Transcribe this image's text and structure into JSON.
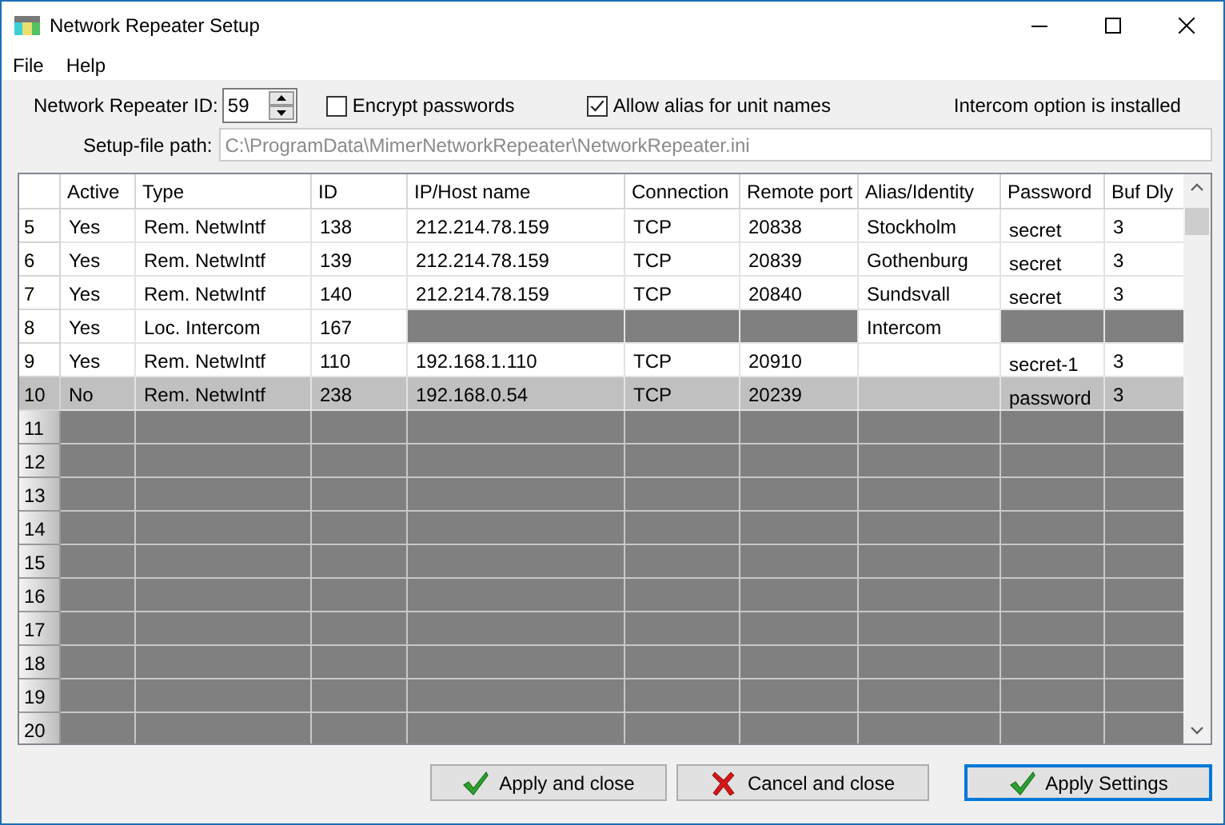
{
  "window": {
    "title": "Network Repeater Setup"
  },
  "menu": [
    "File",
    "Help"
  ],
  "settings": {
    "repeater_id": {
      "label": "Network Repeater ID:",
      "value": "59"
    },
    "options": [
      {
        "label": "Encrypt passwords",
        "checked": false
      },
      {
        "label": "Allow alias for unit names",
        "checked": true
      }
    ],
    "status": "Intercom option is installed",
    "setup_file": {
      "label": "Setup-file path:",
      "value": "C:\\ProgramData\\MimerNetworkRepeater\\NetworkRepeater.ini",
      "disabled": true
    }
  },
  "table": {
    "columns": [
      "Active",
      "Type",
      "ID",
      "IP/Host name",
      "Connection",
      "Remote port",
      "Alias/Identity",
      "Password",
      "Buf Dly"
    ],
    "rows": [
      {
        "number": "5",
        "selected": false,
        "disabled": false,
        "cells": [
          {
            "text": "Yes",
            "disabled": false
          },
          {
            "text": "Rem. NetwIntf",
            "disabled": false
          },
          {
            "text": "138",
            "disabled": false
          },
          {
            "text": "212.214.78.159",
            "disabled": false
          },
          {
            "text": "TCP",
            "disabled": false
          },
          {
            "text": "20838",
            "disabled": false
          },
          {
            "text": "Stockholm",
            "disabled": false
          },
          {
            "text": "secret",
            "disabled": false
          },
          {
            "text": "3",
            "disabled": false
          }
        ]
      },
      {
        "number": "6",
        "selected": false,
        "disabled": false,
        "cells": [
          {
            "text": "Yes",
            "disabled": false
          },
          {
            "text": "Rem. NetwIntf",
            "disabled": false
          },
          {
            "text": "139",
            "disabled": false
          },
          {
            "text": "212.214.78.159",
            "disabled": false
          },
          {
            "text": "TCP",
            "disabled": false
          },
          {
            "text": "20839",
            "disabled": false
          },
          {
            "text": "Gothenburg",
            "disabled": false
          },
          {
            "text": "secret",
            "disabled": false
          },
          {
            "text": "3",
            "disabled": false
          }
        ]
      },
      {
        "number": "7",
        "selected": false,
        "disabled": false,
        "cells": [
          {
            "text": "Yes",
            "disabled": false
          },
          {
            "text": "Rem. NetwIntf",
            "disabled": false
          },
          {
            "text": "140",
            "disabled": false
          },
          {
            "text": "212.214.78.159",
            "disabled": false
          },
          {
            "text": "TCP",
            "disabled": false
          },
          {
            "text": "20840",
            "disabled": false
          },
          {
            "text": "Sundsvall",
            "disabled": false
          },
          {
            "text": "secret",
            "disabled": false
          },
          {
            "text": "3",
            "disabled": false
          }
        ]
      },
      {
        "number": "8",
        "selected": false,
        "disabled": false,
        "cells": [
          {
            "text": "Yes",
            "disabled": false
          },
          {
            "text": "Loc. Intercom",
            "disabled": false
          },
          {
            "text": "167",
            "disabled": false
          },
          {
            "disabled": true
          },
          {
            "disabled": true
          },
          {
            "disabled": true
          },
          {
            "text": "Intercom",
            "disabled": false
          },
          {
            "disabled": true
          },
          {
            "disabled": true
          }
        ]
      },
      {
        "number": "9",
        "selected": false,
        "disabled": false,
        "cells": [
          {
            "text": "Yes",
            "disabled": false
          },
          {
            "text": "Rem. NetwIntf",
            "disabled": false
          },
          {
            "text": "110",
            "disabled": false
          },
          {
            "text": "192.168.1.110",
            "disabled": false
          },
          {
            "text": "TCP",
            "disabled": false
          },
          {
            "text": "20910",
            "disabled": false
          },
          {
            "disabled": false
          },
          {
            "text": "secret-1",
            "disabled": false
          },
          {
            "text": "3",
            "disabled": false
          }
        ]
      },
      {
        "number": "10",
        "selected": true,
        "disabled": false,
        "cells": [
          {
            "text": "No",
            "disabled": false
          },
          {
            "text": "Rem. NetwIntf",
            "disabled": false
          },
          {
            "text": "238",
            "disabled": false
          },
          {
            "text": "192.168.0.54",
            "disabled": false
          },
          {
            "text": "TCP",
            "disabled": false
          },
          {
            "text": "20239",
            "disabled": false
          },
          {
            "disabled": false
          },
          {
            "text": "password",
            "disabled": false
          },
          {
            "text": "3",
            "disabled": false
          }
        ]
      },
      {
        "number": "11",
        "selected": false,
        "disabled": true
      },
      {
        "number": "12",
        "selected": false,
        "disabled": true
      },
      {
        "number": "13",
        "selected": false,
        "disabled": true
      },
      {
        "number": "14",
        "selected": false,
        "disabled": true
      },
      {
        "number": "15",
        "selected": false,
        "disabled": true
      },
      {
        "number": "16",
        "selected": false,
        "disabled": true
      },
      {
        "number": "17",
        "selected": false,
        "disabled": true
      },
      {
        "number": "18",
        "selected": false,
        "disabled": true
      },
      {
        "number": "19",
        "selected": false,
        "disabled": true
      },
      {
        "number": "20",
        "selected": false,
        "disabled": true
      }
    ]
  },
  "buttons": [
    {
      "label": "Apply and close",
      "kind": "apply",
      "default": false
    },
    {
      "label": "Cancel and close",
      "kind": "cancel",
      "default": false
    },
    {
      "label": "Apply Settings",
      "kind": "apply",
      "default": true
    }
  ]
}
